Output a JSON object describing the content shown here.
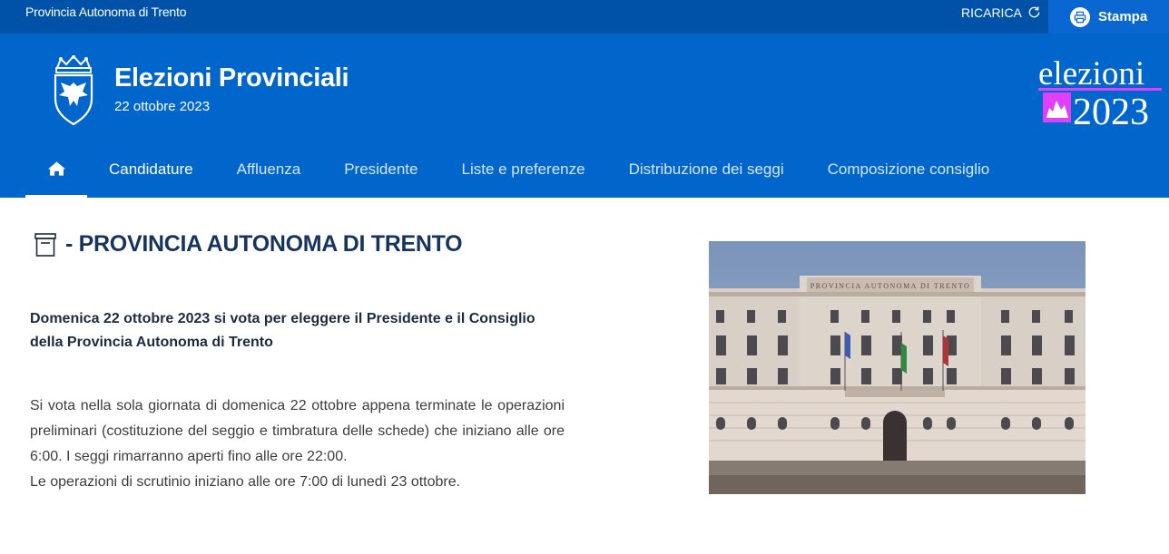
{
  "topbar": {
    "org_name": "Provincia Autonoma di Trento",
    "reload_label": "RICARICA",
    "print_label": "Stampa"
  },
  "header": {
    "title": "Elezioni Provinciali",
    "date": "22 ottobre 2023",
    "brand_word": "elezioni",
    "brand_year": "2023"
  },
  "nav": {
    "home_icon": "home-icon",
    "items": [
      {
        "label": "Candidature"
      },
      {
        "label": "Affluenza"
      },
      {
        "label": "Presidente"
      },
      {
        "label": "Liste e preferenze"
      },
      {
        "label": "Distribuzione dei seggi"
      },
      {
        "label": "Composizione consiglio"
      }
    ]
  },
  "content": {
    "heading": "- PROVINCIA AUTONOMA DI TRENTO",
    "lead": "Domenica 22 ottobre 2023 si vota per eleggere il Presidente e il Consiglio della Provincia Autonoma di Trento",
    "paragraph1": "Si vota nella sola giornata di domenica 22 ottobre appena terminate le operazioni preliminari (costituzione del seggio e timbratura delle schede) che iniziano alle ore 6:00. I seggi rimarranno aperti fino alle ore 22:00.",
    "paragraph2": "Le operazioni di scrutinio iniziano alle ore 7:00 di lunedì 23 ottobre.",
    "photo_sign": "PROVINCIA AUTONOMA DI TRENTO"
  },
  "colors": {
    "topbar": "#0052a8",
    "header": "#0066cc",
    "heading": "#17345e",
    "brand_accent": "#e040fb"
  }
}
